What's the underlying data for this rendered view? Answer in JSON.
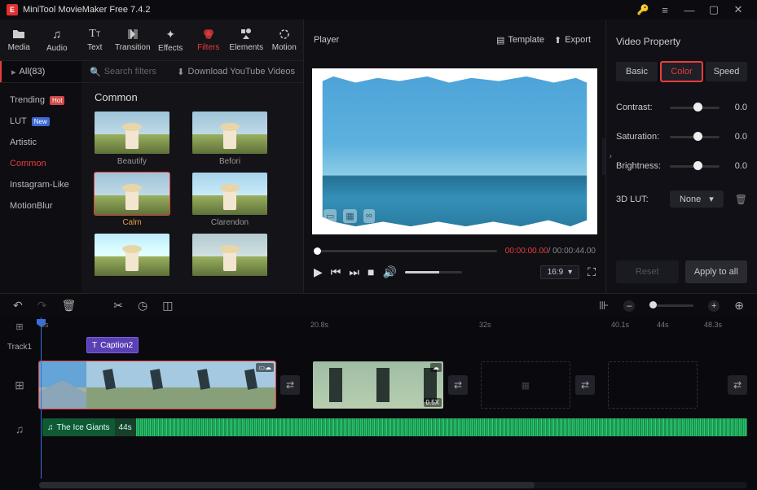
{
  "title": "MiniTool MovieMaker Free 7.4.2",
  "toolTabs": [
    {
      "label": "Media"
    },
    {
      "label": "Audio"
    },
    {
      "label": "Text"
    },
    {
      "label": "Transition"
    },
    {
      "label": "Effects"
    },
    {
      "label": "Filters"
    },
    {
      "label": "Elements"
    },
    {
      "label": "Motion"
    }
  ],
  "filterAll": "All(83)",
  "searchPlaceholder": "Search filters",
  "downloadYT": "Download YouTube Videos",
  "sidebar": [
    {
      "label": "Trending",
      "badge": "Hot"
    },
    {
      "label": "LUT",
      "badge": "New"
    },
    {
      "label": "Artistic"
    },
    {
      "label": "Common"
    },
    {
      "label": "Instagram-Like"
    },
    {
      "label": "MotionBlur"
    }
  ],
  "thumbHeading": "Common",
  "thumbs": [
    {
      "label": "Beautify"
    },
    {
      "label": "Befori"
    },
    {
      "label": "Calm"
    },
    {
      "label": "Clarendon"
    },
    {
      "label": ""
    },
    {
      "label": ""
    }
  ],
  "player": {
    "title": "Player",
    "template": "Template",
    "export": "Export",
    "curTime": "00:00:00.00",
    "totTime": " / 00:00:44.00",
    "ratio": "16:9"
  },
  "props": {
    "title": "Video Property",
    "tabs": [
      "Basic",
      "Color",
      "Speed"
    ],
    "contrast": {
      "label": "Contrast:",
      "val": "0.0"
    },
    "saturation": {
      "label": "Saturation:",
      "val": "0.0"
    },
    "brightness": {
      "label": "Brightness:",
      "val": "0.0"
    },
    "lutLabel": "3D LUT:",
    "lutValue": "None",
    "reset": "Reset",
    "apply": "Apply to all"
  },
  "ruler": [
    "0s",
    "20.8s",
    "32s",
    "40.1s",
    "44s",
    "48.3s"
  ],
  "track1": "Track1",
  "caption": "Caption2",
  "clip2badge": "0.5X",
  "audio": {
    "name": "The Ice Giants",
    "dur": "44s"
  }
}
